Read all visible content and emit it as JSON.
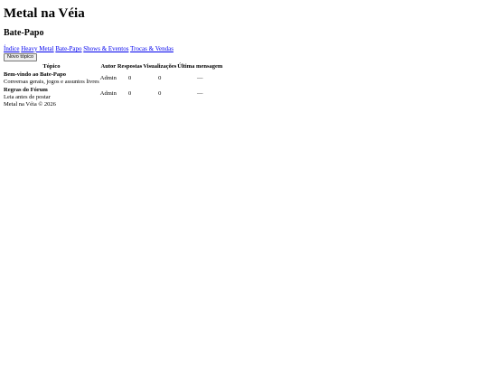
{
  "site_title": "Metal na Véia",
  "page_title": "Bate-Papo",
  "nav": {
    "links": [
      "Índice",
      "Heavy Metal",
      "Bate-Papo",
      "Shows & Eventos",
      "Trocas & Vendas"
    ]
  },
  "new_topic_label": "Novo tópico",
  "table": {
    "headers": [
      "Tópico",
      "Autor",
      "Respostas",
      "Visualizações",
      "Última mensagem"
    ],
    "rows": [
      {
        "title": "Bem-vindo ao Bate-Papo",
        "description": "Conversas gerais, jogos e assuntos livres",
        "author": "Admin",
        "replies": "0",
        "views": "0",
        "last": "—"
      },
      {
        "title": "Regras do Fórum",
        "description": "Leia antes de postar",
        "author": "Admin",
        "replies": "0",
        "views": "0",
        "last": "—"
      }
    ]
  },
  "footer": "Metal na Véia © 2026"
}
